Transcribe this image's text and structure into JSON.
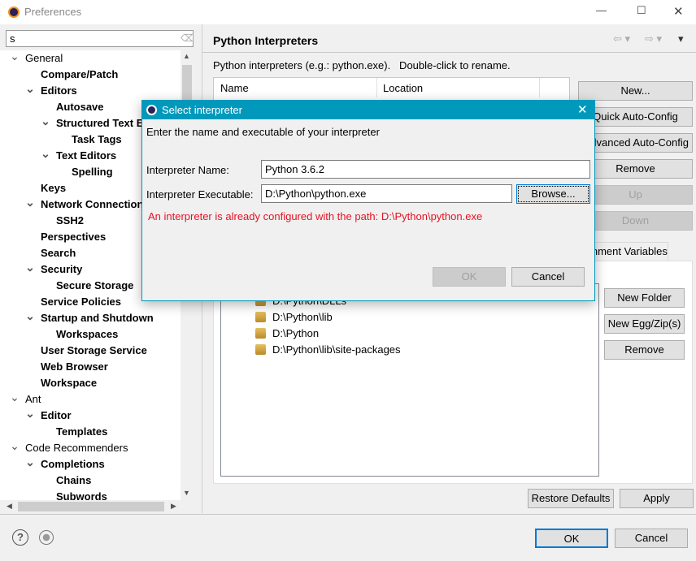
{
  "window": {
    "title": "Preferences",
    "minimize": "—",
    "maximize": "☐",
    "close": "✕"
  },
  "filter": {
    "value": "s"
  },
  "tree": [
    {
      "label": "General",
      "level": 0,
      "expanded": true,
      "bold": false
    },
    {
      "label": "Compare/Patch",
      "level": 1,
      "bold": true
    },
    {
      "label": "Editors",
      "level": 1,
      "expanded": true,
      "bold": true
    },
    {
      "label": "Autosave",
      "level": 2,
      "bold": true
    },
    {
      "label": "Structured Text Editors",
      "level": 2,
      "expanded": true,
      "bold": true
    },
    {
      "label": "Task Tags",
      "level": 3,
      "bold": true
    },
    {
      "label": "Text Editors",
      "level": 2,
      "expanded": true,
      "bold": true
    },
    {
      "label": "Spelling",
      "level": 3,
      "bold": true
    },
    {
      "label": "Keys",
      "level": 1,
      "bold": true
    },
    {
      "label": "Network Connections",
      "level": 1,
      "expanded": true,
      "bold": true
    },
    {
      "label": "SSH2",
      "level": 2,
      "bold": true
    },
    {
      "label": "Perspectives",
      "level": 1,
      "bold": true
    },
    {
      "label": "Search",
      "level": 1,
      "bold": true
    },
    {
      "label": "Security",
      "level": 1,
      "expanded": true,
      "bold": true
    },
    {
      "label": "Secure Storage",
      "level": 2,
      "bold": true
    },
    {
      "label": "Service Policies",
      "level": 1,
      "bold": true
    },
    {
      "label": "Startup and Shutdown",
      "level": 1,
      "expanded": true,
      "bold": true
    },
    {
      "label": "Workspaces",
      "level": 2,
      "bold": true
    },
    {
      "label": "User Storage Service",
      "level": 1,
      "bold": true
    },
    {
      "label": "Web Browser",
      "level": 1,
      "bold": true
    },
    {
      "label": "Workspace",
      "level": 1,
      "bold": true
    },
    {
      "label": "Ant",
      "level": 0,
      "expanded": true,
      "bold": false
    },
    {
      "label": "Editor",
      "level": 1,
      "expanded": true,
      "bold": true
    },
    {
      "label": "Templates",
      "level": 2,
      "bold": true
    },
    {
      "label": "Code Recommenders",
      "level": 0,
      "expanded": true,
      "bold": false
    },
    {
      "label": "Completions",
      "level": 1,
      "expanded": true,
      "bold": true
    },
    {
      "label": "Chains",
      "level": 2,
      "bold": true
    },
    {
      "label": "Subwords",
      "level": 2,
      "bold": true
    }
  ],
  "page": {
    "title": "Python Interpreters",
    "description": "Python interpreters (e.g.: python.exe).   Double-click to rename.",
    "columns": [
      "Name",
      "Location"
    ],
    "buttons": {
      "new": "New...",
      "quick": "Quick Auto-Config",
      "advanced": "Advanced Auto-Config",
      "remove": "Remove",
      "up": "Up",
      "down": "Down"
    },
    "tab_partial": "Environment Variables",
    "libraries": [
      "D:\\Python\\DLLs",
      "D:\\Python\\lib",
      "D:\\Python",
      "D:\\Python\\lib\\site-packages"
    ],
    "lib_buttons": {
      "new_folder": "New Folder",
      "new_egg": "New Egg/Zip(s)",
      "remove": "Remove"
    },
    "restore": "Restore Defaults",
    "apply": "Apply"
  },
  "footer": {
    "ok": "OK",
    "cancel": "Cancel"
  },
  "dialog": {
    "title": "Select interpreter",
    "message": "Enter the name and executable of your interpreter",
    "name_label": "Interpreter Name:",
    "name_value": "Python 3.6.2",
    "exe_label": "Interpreter Executable:",
    "exe_value": "D:\\Python\\python.exe",
    "browse": "Browse...",
    "error": "An interpreter is already configured with the path: D:\\Python\\python.exe",
    "ok": "OK",
    "cancel": "Cancel",
    "accent": "#0099bc",
    "error_color": "#e81123"
  }
}
